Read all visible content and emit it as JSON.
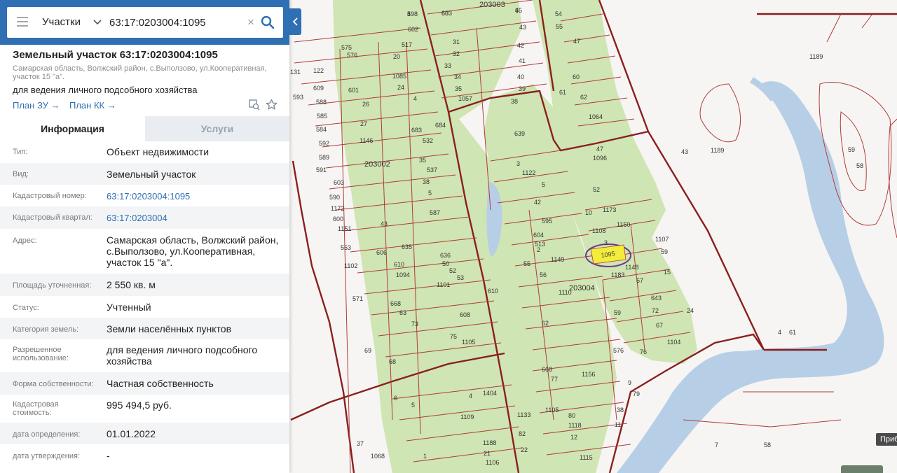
{
  "search": {
    "type_label": "Участки",
    "value": "63:17:0203004:1095",
    "clear_glyph": "×"
  },
  "card": {
    "title": "Земельный участок 63:17:0203004:1095",
    "address": "Самарская область, Волжский район, с.Выползово, ул.Кооперативная, участок 15 \"а\".",
    "use": "для ведения личного подсобного хозяйства",
    "plan_zu": "План ЗУ →",
    "plan_kk": "План КК →"
  },
  "tabs": {
    "info": "Информация",
    "services": "Услуги"
  },
  "attributes": [
    {
      "key": "Тип:",
      "value": "Объект недвижимости"
    },
    {
      "key": "Вид:",
      "value": "Земельный участок"
    },
    {
      "key": "Кадастровый номер:",
      "value": "63:17:0203004:1095"
    },
    {
      "key": "Кадастровый квартал:",
      "value": "63:17:0203004"
    },
    {
      "key": "Адрес:",
      "value": "Самарская область, Волжский район, с.Выползово, ул.Кооперативная, участок 15 \"а\"."
    },
    {
      "key": "Площадь уточненная:",
      "value": "2 550 кв. м"
    },
    {
      "key": "Статус:",
      "value": "Учтенный"
    },
    {
      "key": "Категория земель:",
      "value": "Земли населённых пунктов"
    },
    {
      "key": "Разрешенное использование:",
      "value": "для ведения личного подсобного хозяйства"
    },
    {
      "key": "Форма собственности:",
      "value": "Частная собственность"
    },
    {
      "key": "Кадастровая стоимость:",
      "value": "995 494,5 руб."
    },
    {
      "key": "дата определения:",
      "value": "01.01.2022"
    },
    {
      "key": "дата утверждения:",
      "value": "-"
    }
  ],
  "map": {
    "hint_tag": "Приб",
    "quarter_labels": [
      "203003",
      "203002",
      "203004"
    ],
    "highlight_label": "1095",
    "parcel_labels": [
      "598",
      "633",
      "45",
      "54",
      "602",
      "43",
      "55",
      "575",
      "576",
      "517",
      "20",
      "31",
      "42",
      "47",
      "32",
      "33",
      "41",
      "131",
      "122",
      "1085",
      "34",
      "40",
      "60",
      "609",
      "593",
      "601",
      "24",
      "35",
      "39",
      "588",
      "4",
      "26",
      "1057",
      "38",
      "61",
      "62",
      "585",
      "27",
      "683",
      "684",
      "1146",
      "532",
      "639",
      "1064",
      "584",
      "47",
      "1096",
      "592",
      "35",
      "3",
      "589",
      "537",
      "1122",
      "591",
      "603",
      "38",
      "5",
      "52",
      "590",
      "5",
      "42",
      "10",
      "1173",
      "1172",
      "587",
      "43",
      "600",
      "595",
      "1108",
      "1150",
      "1151",
      "604",
      "513",
      "1107",
      "563",
      "606",
      "635",
      "636",
      "3",
      "59",
      "1102",
      "610",
      "50",
      "52",
      "55",
      "1149",
      "1148",
      "1094",
      "53",
      "2",
      "15",
      "1101",
      "56",
      "1183",
      "67",
      "610",
      "1110",
      "643",
      "571",
      "668",
      "608",
      "63",
      "59",
      "72",
      "73",
      "62",
      "24",
      "75",
      "1105",
      "67",
      "68",
      "69",
      "668",
      "1104",
      "76",
      "576",
      "77",
      "1156",
      "6",
      "4",
      "1404",
      "9",
      "5",
      "79",
      "1105",
      "80",
      "38",
      "1109",
      "1118",
      "11",
      "1133",
      "82",
      "12",
      "37",
      "1188",
      "1068",
      "1",
      "21",
      "1115",
      "1106",
      "22",
      "1189",
      "43",
      "1189",
      "59",
      "58",
      "4",
      "61",
      "7",
      "58",
      "4",
      "60",
      "6"
    ]
  },
  "colors": {
    "header_blue": "#2f6fb3",
    "link_blue": "#2f6fb3",
    "map_green": "#cfe5b3",
    "parcel_line": "#b23a3a",
    "quarter_line": "#8a1f1f",
    "river": "#b7cfe6",
    "highlight": "#f2ec3a",
    "highlight_ring": "#6a3a8c"
  },
  "icons": [
    "menu-icon",
    "chevron-down-icon",
    "clear-icon",
    "search-icon",
    "collapse-arrow-icon",
    "locate-icon",
    "star-icon"
  ]
}
